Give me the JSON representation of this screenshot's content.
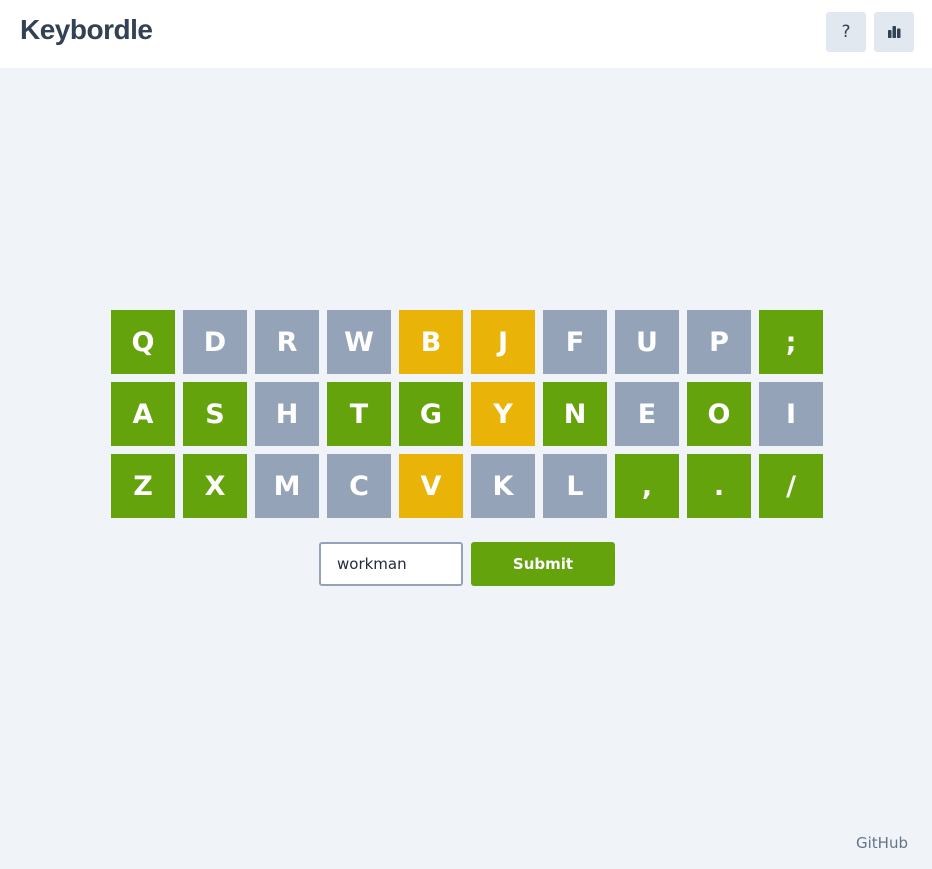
{
  "header": {
    "title": "Keybordle",
    "help_label": "?",
    "help_icon": "question-icon",
    "stats_icon": "bar-chart-icon"
  },
  "colors": {
    "correct": "#65a30d",
    "present": "#eab308",
    "absent": "#94a3b8"
  },
  "board": {
    "rows": [
      [
        {
          "key": "Q",
          "state": "green"
        },
        {
          "key": "D",
          "state": "gray"
        },
        {
          "key": "R",
          "state": "gray"
        },
        {
          "key": "W",
          "state": "gray"
        },
        {
          "key": "B",
          "state": "yellow"
        },
        {
          "key": "J",
          "state": "yellow"
        },
        {
          "key": "F",
          "state": "gray"
        },
        {
          "key": "U",
          "state": "gray"
        },
        {
          "key": "P",
          "state": "gray"
        },
        {
          "key": ";",
          "state": "green"
        }
      ],
      [
        {
          "key": "A",
          "state": "green"
        },
        {
          "key": "S",
          "state": "green"
        },
        {
          "key": "H",
          "state": "gray"
        },
        {
          "key": "T",
          "state": "green"
        },
        {
          "key": "G",
          "state": "green"
        },
        {
          "key": "Y",
          "state": "yellow"
        },
        {
          "key": "N",
          "state": "green"
        },
        {
          "key": "E",
          "state": "gray"
        },
        {
          "key": "O",
          "state": "green"
        },
        {
          "key": "I",
          "state": "gray"
        }
      ],
      [
        {
          "key": "Z",
          "state": "green"
        },
        {
          "key": "X",
          "state": "green"
        },
        {
          "key": "M",
          "state": "gray"
        },
        {
          "key": "C",
          "state": "gray"
        },
        {
          "key": "V",
          "state": "yellow"
        },
        {
          "key": "K",
          "state": "gray"
        },
        {
          "key": "L",
          "state": "gray"
        },
        {
          "key": ",",
          "state": "green"
        },
        {
          "key": ".",
          "state": "green"
        },
        {
          "key": "/",
          "state": "green"
        }
      ]
    ]
  },
  "form": {
    "guess_value": "workman",
    "submit_label": "Submit"
  },
  "footer": {
    "github_label": "GitHub"
  }
}
